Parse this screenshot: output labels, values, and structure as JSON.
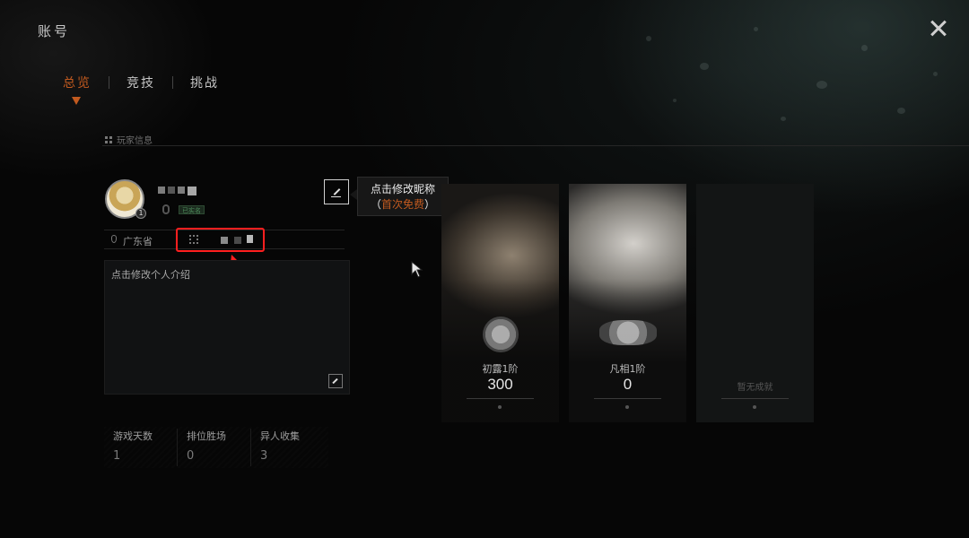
{
  "window": {
    "title": "账号"
  },
  "tabs": [
    {
      "label": "总览",
      "active": true
    },
    {
      "label": "竞技",
      "active": false
    },
    {
      "label": "挑战",
      "active": false
    }
  ],
  "section": {
    "title": "玩家信息"
  },
  "profile": {
    "level": "1",
    "badge": "已实名",
    "location": "广东省",
    "intro_placeholder": "点击修改个人介绍"
  },
  "tooltip": {
    "line1": "点击修改昵称",
    "line2_open": "（",
    "line2_free": "首次免费",
    "line2_close": "）"
  },
  "stats": [
    {
      "label": "游戏天数",
      "value": "1"
    },
    {
      "label": "排位胜场",
      "value": "0"
    },
    {
      "label": "异人收集",
      "value": "3"
    }
  ],
  "cards": [
    {
      "title": "初露1阶",
      "value": "300",
      "icon": "survivor-rank-emblem"
    },
    {
      "title": "凡相1阶",
      "value": "0",
      "icon": "hunter-rank-emblem"
    },
    {
      "title": "",
      "empty_text": "暂无成就"
    }
  ],
  "colors": {
    "accent": "#c25a1f",
    "highlight": "#ff1f1f",
    "background": "#060606"
  }
}
